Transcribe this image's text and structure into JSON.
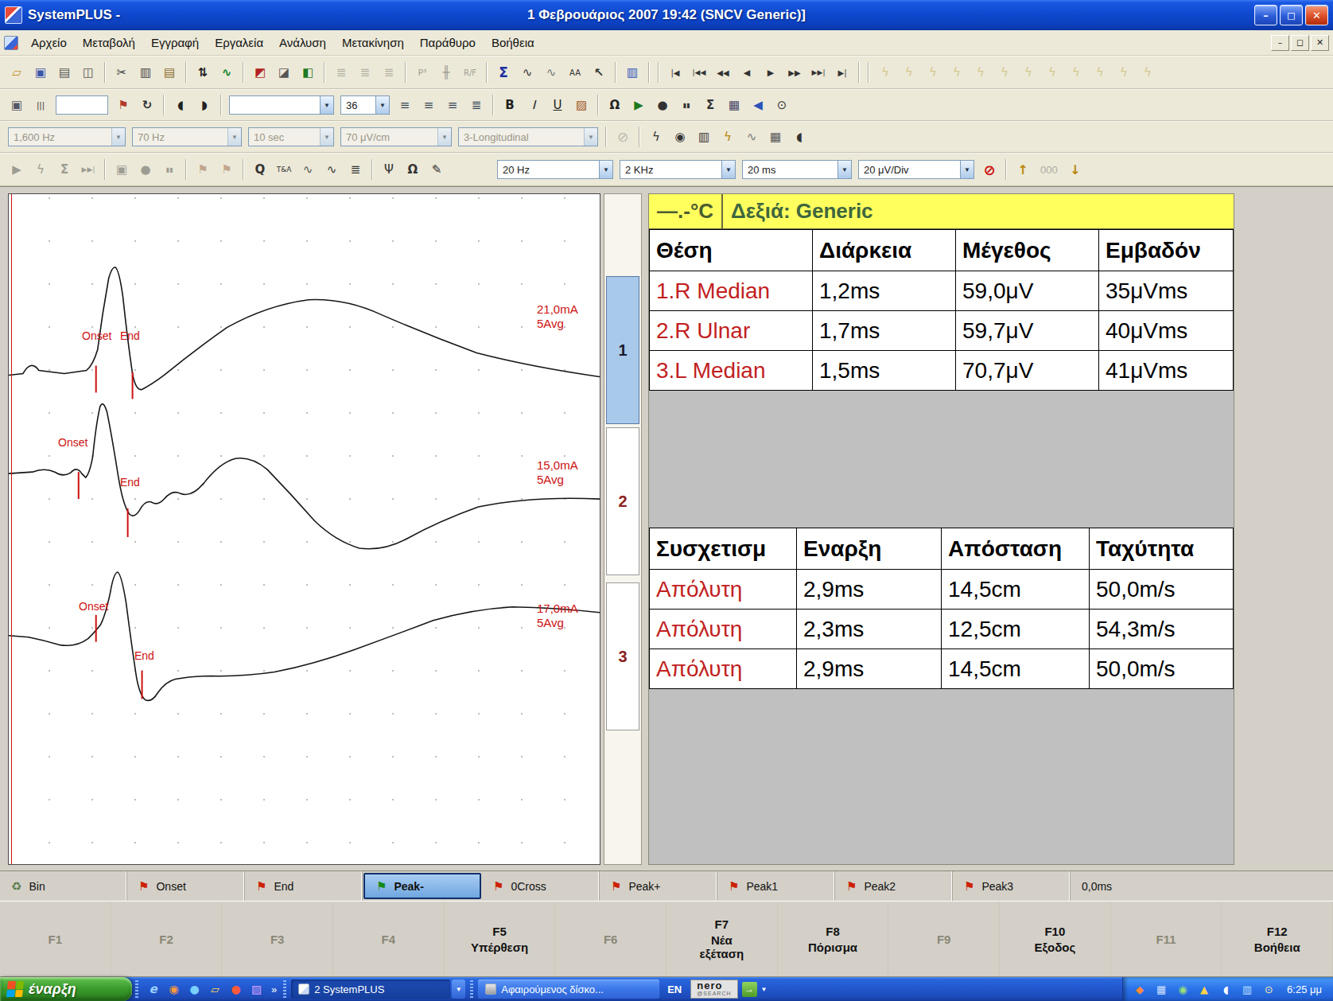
{
  "window": {
    "app_title": "SystemPLUS -",
    "title_text": "1 Φεβρουάριος 2007 19:42 (SNCV Generic)]",
    "controls": {
      "minimize": "–",
      "restore": "◻",
      "close": "✕"
    }
  },
  "menubar": {
    "items": [
      {
        "n": "menu-file",
        "label": "Αρχείο"
      },
      {
        "n": "menu-edit",
        "label": "Μεταβολή"
      },
      {
        "n": "menu-recording",
        "label": "Εγγραφή"
      },
      {
        "n": "menu-tools",
        "label": "Εργαλεία"
      },
      {
        "n": "menu-analysis",
        "label": "Ανάλυση"
      },
      {
        "n": "menu-navigation",
        "label": "Μετακίνηση"
      },
      {
        "n": "menu-window",
        "label": "Παράθυρο"
      },
      {
        "n": "menu-help",
        "label": "Βοήθεια"
      }
    ],
    "controls": {
      "minimize": "–",
      "restore": "◻",
      "close": "✕"
    }
  },
  "toolbars": {
    "row1": [
      {
        "t": "b",
        "n": "open-file-icon",
        "g": "▱",
        "c": "#c8922a",
        "b": 1
      },
      {
        "t": "b",
        "n": "save-icon",
        "g": "▣",
        "c": "#3a55a8"
      },
      {
        "t": "b",
        "n": "print-icon",
        "g": "▤",
        "c": "#555"
      },
      {
        "t": "b",
        "n": "print-preview-icon",
        "g": "◫",
        "c": "#555"
      },
      {
        "t": "s"
      },
      {
        "t": "b",
        "n": "cut-icon",
        "g": "✂",
        "c": "#444"
      },
      {
        "t": "b",
        "n": "copy-icon",
        "g": "▥",
        "c": "#444"
      },
      {
        "t": "b",
        "n": "paste-icon",
        "g": "▤",
        "c": "#8a6a2a"
      },
      {
        "t": "s"
      },
      {
        "t": "b",
        "n": "sort-traces-icon",
        "g": "⇅",
        "c": "#222",
        "b": 1
      },
      {
        "t": "b",
        "n": "waveform-color-icon",
        "g": "∿",
        "c": "#13862f",
        "b": 1
      },
      {
        "t": "s"
      },
      {
        "t": "b",
        "n": "marker-flag-icon",
        "g": "◩",
        "c": "#b22222"
      },
      {
        "t": "b",
        "n": "marker-box-icon",
        "g": "◪",
        "c": "#555"
      },
      {
        "t": "b",
        "n": "marker-check-icon",
        "g": "◧",
        "c": "#1f7a1f"
      },
      {
        "t": "s"
      },
      {
        "t": "b",
        "n": "trace-grid-1-icon",
        "g": "≣",
        "c": "#666",
        "d": 1
      },
      {
        "t": "b",
        "n": "trace-grid-2-icon",
        "g": "≣",
        "c": "#666",
        "d": 1
      },
      {
        "t": "b",
        "n": "trace-grid-3-icon",
        "g": "≣",
        "c": "#666",
        "d": 1
      },
      {
        "t": "s"
      },
      {
        "t": "b",
        "n": "p300-icon",
        "g": "P³",
        "f": 11,
        "d": 1
      },
      {
        "t": "b",
        "n": "spike-train-icon",
        "g": "╫",
        "d": 1
      },
      {
        "t": "b",
        "n": "rf-ratio-icon",
        "g": "R/F",
        "f": 10,
        "d": 1
      },
      {
        "t": "s"
      },
      {
        "t": "b",
        "n": "summation-icon",
        "g": "Σ",
        "c": "#1b2fa0",
        "b": 1,
        "f": 17
      },
      {
        "t": "b",
        "n": "wave-analyze-icon",
        "g": "∿",
        "c": "#333"
      },
      {
        "t": "b",
        "n": "wave-measure-icon",
        "g": "∿",
        "c": "#777"
      },
      {
        "t": "b",
        "n": "averaging-icon",
        "g": "AA",
        "f": 10,
        "c": "#333"
      },
      {
        "t": "b",
        "n": "pointer-icon",
        "g": "↖",
        "c": "#333",
        "b": 1
      },
      {
        "t": "s"
      },
      {
        "t": "b",
        "n": "notebook-icon",
        "g": "▥",
        "c": "#2a52b8"
      },
      {
        "t": "s"
      },
      {
        "t": "s"
      },
      {
        "t": "b",
        "n": "nav-first-icon",
        "g": "|◀",
        "f": 10
      },
      {
        "t": "b",
        "n": "nav-prev-page-icon",
        "g": "|◀◀",
        "f": 9
      },
      {
        "t": "b",
        "n": "nav-rewind-icon",
        "g": "◀◀",
        "f": 10
      },
      {
        "t": "b",
        "n": "nav-back-icon",
        "g": "◀",
        "f": 11
      },
      {
        "t": "b",
        "n": "nav-forward-icon",
        "g": "▶",
        "f": 11
      },
      {
        "t": "b",
        "n": "nav-ffwd-icon",
        "g": "▶▶",
        "f": 10
      },
      {
        "t": "b",
        "n": "nav-next-page-icon",
        "g": "▶▶|",
        "f": 9
      },
      {
        "t": "b",
        "n": "nav-last-icon",
        "g": "▶|",
        "f": 10
      },
      {
        "t": "s"
      },
      {
        "t": "s"
      },
      {
        "t": "b",
        "n": "stim-macro-1-icon",
        "g": "ϟ",
        "c": "#b89a2a",
        "d": 1,
        "f": 15
      },
      {
        "t": "b",
        "n": "stim-macro-2-icon",
        "g": "ϟ",
        "c": "#b89a2a",
        "d": 1,
        "f": 15
      },
      {
        "t": "b",
        "n": "stim-macro-3-icon",
        "g": "ϟ",
        "c": "#b89a2a",
        "d": 1,
        "f": 15
      },
      {
        "t": "b",
        "n": "stim-macro-4-icon",
        "g": "ϟ",
        "c": "#b89a2a",
        "d": 1,
        "f": 15
      },
      {
        "t": "b",
        "n": "stim-macro-5-icon",
        "g": "ϟ",
        "c": "#b89a2a",
        "d": 1,
        "f": 15
      },
      {
        "t": "b",
        "n": "stim-macro-6-icon",
        "g": "ϟ",
        "c": "#b89a2a",
        "d": 1,
        "f": 15
      },
      {
        "t": "b",
        "n": "stim-macro-7-icon",
        "g": "ϟ",
        "c": "#b89a2a",
        "d": 1,
        "f": 15
      },
      {
        "t": "b",
        "n": "stim-macro-8-icon",
        "g": "ϟ",
        "c": "#b89a2a",
        "d": 1,
        "f": 15
      },
      {
        "t": "b",
        "n": "stim-macro-9-icon",
        "g": "ϟ",
        "c": "#b89a2a",
        "d": 1,
        "f": 15
      },
      {
        "t": "b",
        "n": "stim-macro-10-icon",
        "g": "ϟ",
        "c": "#b89a2a",
        "d": 1,
        "f": 15
      },
      {
        "t": "b",
        "n": "stim-macro-11-icon",
        "g": "ϟ",
        "c": "#b89a2a",
        "d": 1,
        "f": 15
      },
      {
        "t": "b",
        "n": "stim-macro-12-icon",
        "g": "ϟ",
        "c": "#b89a2a",
        "d": 1,
        "f": 15
      }
    ],
    "row2": [
      {
        "t": "b",
        "n": "report-image-icon",
        "g": "▣",
        "c": "#556"
      },
      {
        "t": "b",
        "n": "column-layout-icon",
        "g": "|||",
        "f": 10
      },
      {
        "t": "i",
        "n": "quick-text-field",
        "w": 66
      },
      {
        "t": "b",
        "n": "flag-insert-icon",
        "g": "⚑",
        "c": "#b23a2a"
      },
      {
        "t": "b",
        "n": "page-refresh-icon",
        "g": "↻",
        "c": "#333",
        "b": 1
      },
      {
        "t": "s"
      },
      {
        "t": "b",
        "n": "pan-left-icon",
        "g": "◖",
        "c": "#222"
      },
      {
        "t": "b",
        "n": "pan-right-icon",
        "g": "◗",
        "c": "#222"
      },
      {
        "t": "s"
      },
      {
        "t": "d",
        "n": "font-name-dropdown",
        "l": "",
        "w": 132
      },
      {
        "t": "d",
        "n": "font-size-dropdown",
        "l": "36",
        "w": 62
      },
      {
        "t": "b",
        "n": "align-left-icon",
        "g": "≡",
        "c": "#345"
      },
      {
        "t": "b",
        "n": "align-center-icon",
        "g": "≡",
        "c": "#345"
      },
      {
        "t": "b",
        "n": "align-right-icon",
        "g": "≡",
        "c": "#345"
      },
      {
        "t": "b",
        "n": "align-justify-icon",
        "g": "≣",
        "c": "#345"
      },
      {
        "t": "s"
      },
      {
        "t": "b",
        "n": "bold-icon",
        "g": "B",
        "b": 1,
        "c": "#222"
      },
      {
        "t": "b",
        "n": "italic-icon",
        "g": "I",
        "i": 1,
        "c": "#222"
      },
      {
        "t": "b",
        "n": "underline-icon",
        "g": "U",
        "u": 1,
        "c": "#222"
      },
      {
        "t": "b",
        "n": "text-color-icon",
        "g": "▨",
        "c": "#a05a28"
      },
      {
        "t": "s"
      },
      {
        "t": "b",
        "n": "impedance-icon",
        "g": "Ω",
        "c": "#222",
        "b": 1
      },
      {
        "t": "b",
        "n": "play-icon",
        "g": "▶",
        "c": "#1e7a1e"
      },
      {
        "t": "b",
        "n": "record-icon",
        "g": "●",
        "c": "#333"
      },
      {
        "t": "b",
        "n": "pause-icon",
        "g": "▮▮",
        "f": 8
      },
      {
        "t": "b",
        "n": "sum-icon",
        "g": "Σ",
        "c": "#333",
        "b": 1
      },
      {
        "t": "b",
        "n": "montage-grid-icon",
        "g": "▦",
        "c": "#446"
      },
      {
        "t": "b",
        "n": "back-icon",
        "g": "◀",
        "c": "#2a52b8"
      },
      {
        "t": "b",
        "n": "timer-icon",
        "g": "⊙",
        "c": "#333"
      }
    ],
    "row3": [
      {
        "t": "d",
        "n": "sample-rate-dropdown",
        "l": "1,600 Hz",
        "w": 148,
        "d": 1
      },
      {
        "t": "d",
        "n": "low-cut-dropdown",
        "l": "70 Hz",
        "w": 138,
        "d": 1
      },
      {
        "t": "d",
        "n": "sweep-duration-dropdown",
        "l": "10 sec",
        "w": 108,
        "d": 1
      },
      {
        "t": "d",
        "n": "gain-dropdown",
        "l": "70 μV/cm",
        "w": 140,
        "d": 1
      },
      {
        "t": "d",
        "n": "montage-dropdown",
        "l": "3-Longitudinal",
        "w": 176,
        "d": 1
      },
      {
        "t": "s"
      },
      {
        "t": "b",
        "n": "stim-off-icon",
        "g": "⊘",
        "c": "#777",
        "f": 17,
        "d": 1
      },
      {
        "t": "s"
      },
      {
        "t": "b",
        "n": "stim-audio-icon",
        "g": "ϟ",
        "c": "#333",
        "f": 15
      },
      {
        "t": "b",
        "n": "snapshot-icon",
        "g": "◉",
        "c": "#333"
      },
      {
        "t": "b",
        "n": "recorder-icon",
        "g": "▥",
        "c": "#333"
      },
      {
        "t": "b",
        "n": "stim-bolt-icon",
        "g": "ϟ",
        "c": "#b8860b",
        "f": 15
      },
      {
        "t": "b",
        "n": "trend-icon",
        "g": "∿",
        "c": "#777"
      },
      {
        "t": "b",
        "n": "review-grid-icon",
        "g": "▦",
        "c": "#555"
      },
      {
        "t": "b",
        "n": "speaker-icon",
        "g": "◖",
        "c": "#333"
      }
    ],
    "row4": [
      {
        "t": "b",
        "n": "play-icon",
        "g": "▶",
        "d": 1
      },
      {
        "t": "b",
        "n": "stim-icon",
        "g": "ϟ",
        "d": 1,
        "f": 15
      },
      {
        "t": "b",
        "n": "average-icon",
        "g": "Σ",
        "d": 1,
        "b": 1
      },
      {
        "t": "b",
        "n": "skip-icon",
        "g": "▶▶|",
        "f": 9,
        "d": 1
      },
      {
        "t": "s"
      },
      {
        "t": "b",
        "n": "store-icon",
        "g": "▣",
        "d": 1
      },
      {
        "t": "b",
        "n": "record-icon",
        "g": "●",
        "d": 1
      },
      {
        "t": "b",
        "n": "pause-icon",
        "g": "▮▮",
        "f": 8,
        "d": 1
      },
      {
        "t": "s"
      },
      {
        "t": "b",
        "n": "flag-trace-1-icon",
        "g": "⚑",
        "c": "#8a4a2a",
        "d": 1
      },
      {
        "t": "b",
        "n": "flag-trace-2-icon",
        "g": "⚑",
        "c": "#8a4a2a",
        "d": 1
      },
      {
        "t": "s"
      },
      {
        "t": "b",
        "n": "q-marker-icon",
        "g": "Q",
        "c": "#333",
        "b": 1
      },
      {
        "t": "b",
        "n": "ta-marker-icon",
        "g": "T&A",
        "f": 9,
        "c": "#333"
      },
      {
        "t": "b",
        "n": "wave-flags-icon",
        "g": "∿",
        "c": "#555"
      },
      {
        "t": "b",
        "n": "zero-cross-icon",
        "g": "∿",
        "c": "#333"
      },
      {
        "t": "b",
        "n": "comb-filter-icon",
        "g": "≣",
        "c": "#333"
      },
      {
        "t": "s"
      },
      {
        "t": "b",
        "n": "stim-probe-icon",
        "g": "Ψ",
        "c": "#333"
      },
      {
        "t": "b",
        "n": "impedance-icon",
        "g": "Ω",
        "c": "#333",
        "b": 1
      },
      {
        "t": "b",
        "n": "annotate-icon",
        "g": "✎",
        "c": "#333"
      },
      {
        "t": "gap",
        "w": 55
      },
      {
        "t": "d",
        "n": "low-freq-dropdown",
        "l": "20 Hz",
        "w": 146
      },
      {
        "t": "d",
        "n": "high-freq-dropdown",
        "l": "2 KHz",
        "w": 146
      },
      {
        "t": "d",
        "n": "timebase-dropdown",
        "l": "20 ms",
        "w": 138
      },
      {
        "t": "d",
        "n": "sensitivity-dropdown",
        "l": "20 μV/Div",
        "w": 146
      },
      {
        "t": "b",
        "n": "stim-disabled-icon",
        "g": "⊘",
        "c": "#cc1111",
        "f": 18,
        "b": 1
      },
      {
        "t": "s"
      },
      {
        "t": "b",
        "n": "intensity-up-icon",
        "g": "↑",
        "c": "#b8860b",
        "b": 1,
        "f": 16
      },
      {
        "t": "x",
        "n": "intensity-value",
        "l": "000",
        "d": 1
      },
      {
        "t": "b",
        "n": "intensity-down-icon",
        "g": "↓",
        "c": "#b8860b",
        "b": 1,
        "f": 16
      }
    ]
  },
  "channels": [
    {
      "label": "1",
      "selected": true
    },
    {
      "label": "2",
      "selected": false
    },
    {
      "label": "3",
      "selected": false
    }
  ],
  "waveform": {
    "traces": [
      {
        "channel": "1",
        "current": "21,0mA",
        "averages": "5Avg",
        "onset_label": "Onset",
        "end_label": "End"
      },
      {
        "channel": "2",
        "current": "15,0mA",
        "averages": "5Avg",
        "onset_label": "Onset",
        "end_label": "End"
      },
      {
        "channel": "3",
        "current": "17,0mA",
        "averages": "5Avg",
        "onset_label": "Onset",
        "end_label": "End"
      }
    ]
  },
  "results": {
    "temperature": "—.-°C",
    "side_label": "Δεξιά: Generic",
    "table1": {
      "headers": [
        "Θέση",
        "Διάρκεια",
        "Μέγεθος",
        "Εμβαδόν"
      ],
      "rows": [
        [
          "1.R Median",
          "1,2ms",
          "59,0μV",
          "35μVms"
        ],
        [
          "2.R Ulnar",
          "1,7ms",
          "59,7μV",
          "40μVms"
        ],
        [
          "3.L Median",
          "1,5ms",
          "70,7μV",
          "41μVms"
        ]
      ]
    },
    "table2": {
      "headers": [
        "Συσχετισμ",
        "Εναρξη",
        "Απόσταση",
        "Ταχύτητα"
      ],
      "rows": [
        [
          "Απόλυτη",
          "2,9ms",
          "14,5cm",
          "50,0m/s"
        ],
        [
          "Απόλυτη",
          "2,3ms",
          "12,5cm",
          "54,3m/s"
        ],
        [
          "Απόλυτη",
          "2,9ms",
          "14,5cm",
          "50,0m/s"
        ]
      ]
    }
  },
  "marker_bar": {
    "items": [
      {
        "n": "bin-button",
        "label": "Bin",
        "kind": "bin",
        "w": 160
      },
      {
        "n": "onset-marker-button",
        "label": "Onset",
        "flag": "#cc2200",
        "w": 148
      },
      {
        "n": "end-marker-button",
        "label": "End",
        "flag": "#cc2200",
        "w": 148
      },
      {
        "n": "peak-minus-marker-button",
        "label": "Peak-",
        "flag": "#168a16",
        "selected": true,
        "w": 148
      },
      {
        "n": "zero-cross-marker-button",
        "label": "0Cross",
        "flag": "#cc2200",
        "w": 148
      },
      {
        "n": "peak-plus-marker-button",
        "label": "Peak+",
        "flag": "#cc2200",
        "w": 148
      },
      {
        "n": "peak1-marker-button",
        "label": "Peak1",
        "flag": "#cc2200",
        "w": 148
      },
      {
        "n": "peak2-marker-button",
        "label": "Peak2",
        "flag": "#cc2200",
        "w": 148
      },
      {
        "n": "peak3-marker-button",
        "label": "Peak3",
        "flag": "#cc2200",
        "w": 148
      },
      {
        "n": "marker-time-display",
        "label": "0,0ms",
        "kind": "text",
        "w": 130
      }
    ]
  },
  "function_keys": [
    {
      "key": "F1",
      "label": "",
      "enabled": false
    },
    {
      "key": "F2",
      "label": "",
      "enabled": false
    },
    {
      "key": "F3",
      "label": "",
      "enabled": false
    },
    {
      "key": "F4",
      "label": "",
      "enabled": false
    },
    {
      "key": "F5",
      "label": "Υπέρθεση",
      "enabled": true
    },
    {
      "key": "F6",
      "label": "",
      "enabled": false
    },
    {
      "key": "F7",
      "label": "Νέα\nεξέταση",
      "enabled": true
    },
    {
      "key": "F8",
      "label": "Πόρισμα",
      "enabled": true
    },
    {
      "key": "F9",
      "label": "",
      "enabled": false
    },
    {
      "key": "F10",
      "label": "Εξοδος",
      "enabled": true
    },
    {
      "key": "F11",
      "label": "",
      "enabled": false
    },
    {
      "key": "F12",
      "label": "Βοήθεια",
      "enabled": true
    }
  ],
  "taskbar": {
    "start_label": "έναρξη",
    "overflow_chevron": "»",
    "quicklaunch": [
      {
        "n": "quicklaunch-ie-icon",
        "g": "e",
        "c": "#9ad0ff",
        "b": 1,
        "i": 1,
        "f": 15
      },
      {
        "n": "quicklaunch-media-player-icon",
        "g": "◉",
        "c": "#ff9a3a"
      },
      {
        "n": "quicklaunch-messenger-icon",
        "g": "●",
        "c": "#7ad0ff"
      },
      {
        "n": "quicklaunch-folder-icon",
        "g": "▱",
        "c": "#ffd24a"
      },
      {
        "n": "quicklaunch-browser-icon",
        "g": "●",
        "c": "#ff5a3a"
      },
      {
        "n": "quicklaunch-photo-icon",
        "g": "▨",
        "c": "#d0a0ff"
      }
    ],
    "tasks": [
      "2 SystemPLUS",
      "Αφαιρούμενος δίσκο..."
    ],
    "task_chevron": "▼",
    "language": "EN",
    "nero": {
      "line1": "nero",
      "line2": "@SEARCH",
      "go_glyph": "→",
      "chevron": "▼"
    },
    "tray_icons": [
      {
        "n": "tray-stimulator-icon",
        "g": "◆",
        "c": "#ff8a3a"
      },
      {
        "n": "tray-display-icon",
        "g": "▦",
        "c": "#cfe2ff"
      },
      {
        "n": "tray-safely-remove-icon",
        "g": "◉",
        "c": "#9adf7a"
      },
      {
        "n": "tray-antivirus-icon",
        "g": "▲",
        "c": "#ffd24a"
      },
      {
        "n": "tray-volume-icon",
        "g": "◖",
        "c": "#ffffff"
      },
      {
        "n": "tray-network-icon",
        "g": "▥",
        "c": "#bfe0ff"
      },
      {
        "n": "tray-scheduler-icon",
        "g": "⊙",
        "c": "#ffe9a8"
      }
    ],
    "clock": "6:25 μμ"
  }
}
